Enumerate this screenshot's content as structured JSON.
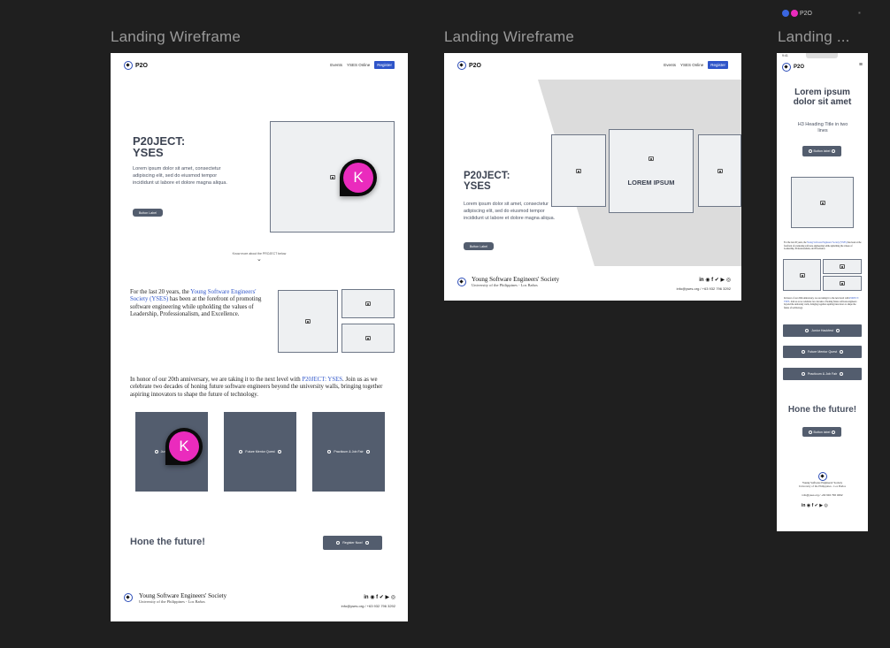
{
  "frames": [
    {
      "label": "Landing Wireframe"
    },
    {
      "label": "Landing Wireframe"
    },
    {
      "label": "Landing ..."
    }
  ],
  "nav": {
    "events": "Events",
    "online": "YSES Online",
    "register": "Register"
  },
  "logo": {
    "text": "P2O"
  },
  "hero": {
    "title_line1": "P20JECT:",
    "title_line2": "YSES",
    "body": "Lorem ipsum dolor sit amet, consectetur adipiscing elit, sed do eiusmod tempor incididunt ut labore et dolore magna aliqua.",
    "button": "Button Label",
    "scroll_hint": "Know more about the PROJECT below"
  },
  "about": {
    "pre": "For the last 20 years, the ",
    "link": "Young Software Engineers' Society (YSES)",
    "post": " has been at the forefront of promoting software engineering while upholding the values of Leadership, Professionalism, and Excellence."
  },
  "honor": {
    "pre": "In honor of our 20th anniversary, we are taking it to the next level with ",
    "link": "P20JECT: YSES",
    "post": ". Join us as we celebrate two decades of honing future software engineers beyond the university walls, bringing together aspiring innovators to shape the future of technology."
  },
  "cards": [
    "Junior Hackfest",
    "Future Mentor Quest",
    "Practicum & Job Fair"
  ],
  "cta": {
    "title": "Hone the future!",
    "button": "Register Now!",
    "button_mobile": "Button label"
  },
  "footer": {
    "org": "Young Software Engineers' Society",
    "sub": "University of the Philippines - Los Baños",
    "contact": "info@yses.org / +63 932 796 3292",
    "socials": "in ◉ f ✔ ▶ ◎"
  },
  "tablet": {
    "carousel_label": "LOREM IPSUM",
    "button": "Button Label"
  },
  "mobile": {
    "status_time": "9:41",
    "title": "Lorem ipsum dolor sit amet",
    "subtitle": "H3 Heading Title in two lines",
    "button": "Button label",
    "contact": "info@yses.org / +63 932 796 3292",
    "menu_icon": "hamburger-icon"
  },
  "collab": {
    "user_initial": "K",
    "user_color": "#ea2bbd"
  }
}
